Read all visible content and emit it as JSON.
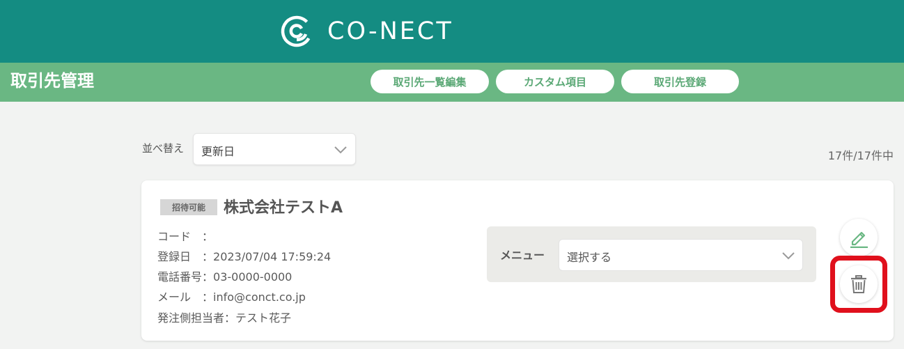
{
  "header": {
    "brand": "CO-NECT",
    "bg_color": "#148c82"
  },
  "subbar": {
    "title": "取引先管理",
    "bg_color": "#6ab783",
    "buttons": [
      {
        "label": "取引先一覧編集"
      },
      {
        "label": "カスタム項目"
      },
      {
        "label": "取引先登録"
      }
    ]
  },
  "sort": {
    "label": "並べ替え",
    "selected": "更新日"
  },
  "count_text": "17件/17件中",
  "card": {
    "badge": "招待可能",
    "company": "株式会社テストA",
    "fields": [
      {
        "key": "コード　：",
        "value": ""
      },
      {
        "key": "登録日　：",
        "value": "2023/07/04 17:59:24"
      },
      {
        "key": "電話番号：",
        "value": "03-0000-0000"
      },
      {
        "key": "メール　：",
        "value": "info@conct.co.jp"
      },
      {
        "key": "発注側担当者：",
        "value": "テスト花子"
      }
    ],
    "menu_label": "メニュー",
    "menu_selected": "選択する",
    "icons": [
      "pencil-icon",
      "trash-icon"
    ],
    "highlight_color": "#e0101c"
  }
}
